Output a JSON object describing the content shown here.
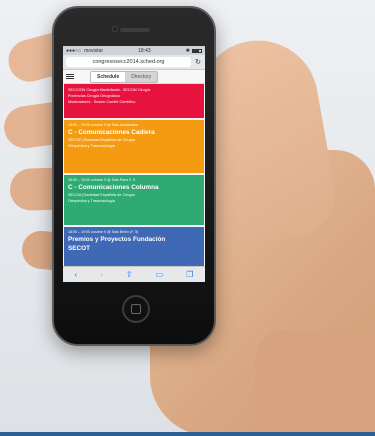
{
  "status_bar": {
    "carrier": "movistar",
    "signal": "●●●○○",
    "time": "18:43",
    "bluetooth": "✱"
  },
  "browser": {
    "url": "congresosecc2014.sched.org"
  },
  "app": {
    "tabs": [
      {
        "label": "Schedule",
        "active": true
      },
      {
        "label": "Directory",
        "active": false
      }
    ]
  },
  "sessions": [
    {
      "color": "#e8123f",
      "time": "",
      "title": "",
      "line1": "SECCIÓN Cirugía Maxilofacial - SECOM Cirugía",
      "line2": "Ponencias Cirugía Ortognática",
      "line3": "Moderadores · Sesión Comité Científico"
    },
    {
      "color": "#f59b12",
      "time": "18:00 – 19:00 octubre 9 @ Sala Amsterdam",
      "title": "C - Comunicaciones Cadiera",
      "line1": "SECOE (Sociedad Española de Cirugía",
      "line2": "Ortopédica y Traumatología"
    },
    {
      "color": "#2faa73",
      "time": "18:00 – 19:00 octubre 9 @ Sala París F. 5",
      "title": "C - Comunicaciones Columna",
      "line1": "SECOA (Sociedad Española de Cirugía",
      "line2": "Ortopédica y Traumatología"
    },
    {
      "color": "#3f68b5",
      "time": "18:00 – 19:00 octubre 9 @ Sala Berlín (F. 5)",
      "title": "Premios y Proyectos Fundación",
      "title2": "SECOT"
    }
  ],
  "toolbar_icons": [
    "back-icon",
    "forward-icon",
    "share-icon",
    "bookmarks-icon",
    "tabs-icon"
  ]
}
